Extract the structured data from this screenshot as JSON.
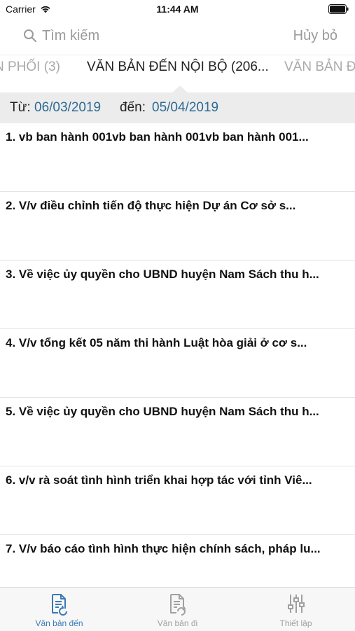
{
  "status_bar": {
    "carrier": "Carrier",
    "time": "11:44 AM"
  },
  "search": {
    "placeholder": "Tìm kiếm",
    "cancel_label": "Hủy bỏ"
  },
  "tabs": [
    {
      "label": "N PHỐI (3)",
      "state": "partial"
    },
    {
      "label": "VĂN BẢN ĐẾN NỘI BỘ (206...",
      "state": "selected"
    },
    {
      "label": "VĂN BẢN Đ",
      "state": "partial"
    }
  ],
  "date_range": {
    "from_label": "Từ:",
    "from_value": "06/03/2019",
    "to_label": "đến:",
    "to_value": "05/04/2019"
  },
  "documents": [
    "1. vb ban hành 001vb ban hành 001vb ban hành 001...",
    "2. V/v điều chỉnh tiến độ thực hiện Dự án Cơ sở s...",
    "3. Về việc ủy quyền cho UBND huyện Nam Sách thu h...",
    "4. V/v tổng kết 05 năm thi hành Luật hòa giải ở cơ s...",
    "5. Về việc ủy quyền cho UBND huyện Nam Sách thu h...",
    "6. v/v rà soát tình hình triển khai hợp tác với tỉnh Viê...",
    "7. V/v báo cáo tình hình thực hiện chính sách, pháp lu..."
  ],
  "bottom_tabs": [
    {
      "label": "Văn bản đến",
      "icon": "incoming-document-icon",
      "active": true
    },
    {
      "label": "Văn bản đi",
      "icon": "outgoing-document-icon",
      "active": false
    },
    {
      "label": "Thiết lập",
      "icon": "settings-sliders-icon",
      "active": false
    }
  ],
  "colors": {
    "accent": "#3a7ab8",
    "date_value": "#2d6a93",
    "muted": "#9b9b9b",
    "date_bar_bg": "#ececec"
  }
}
